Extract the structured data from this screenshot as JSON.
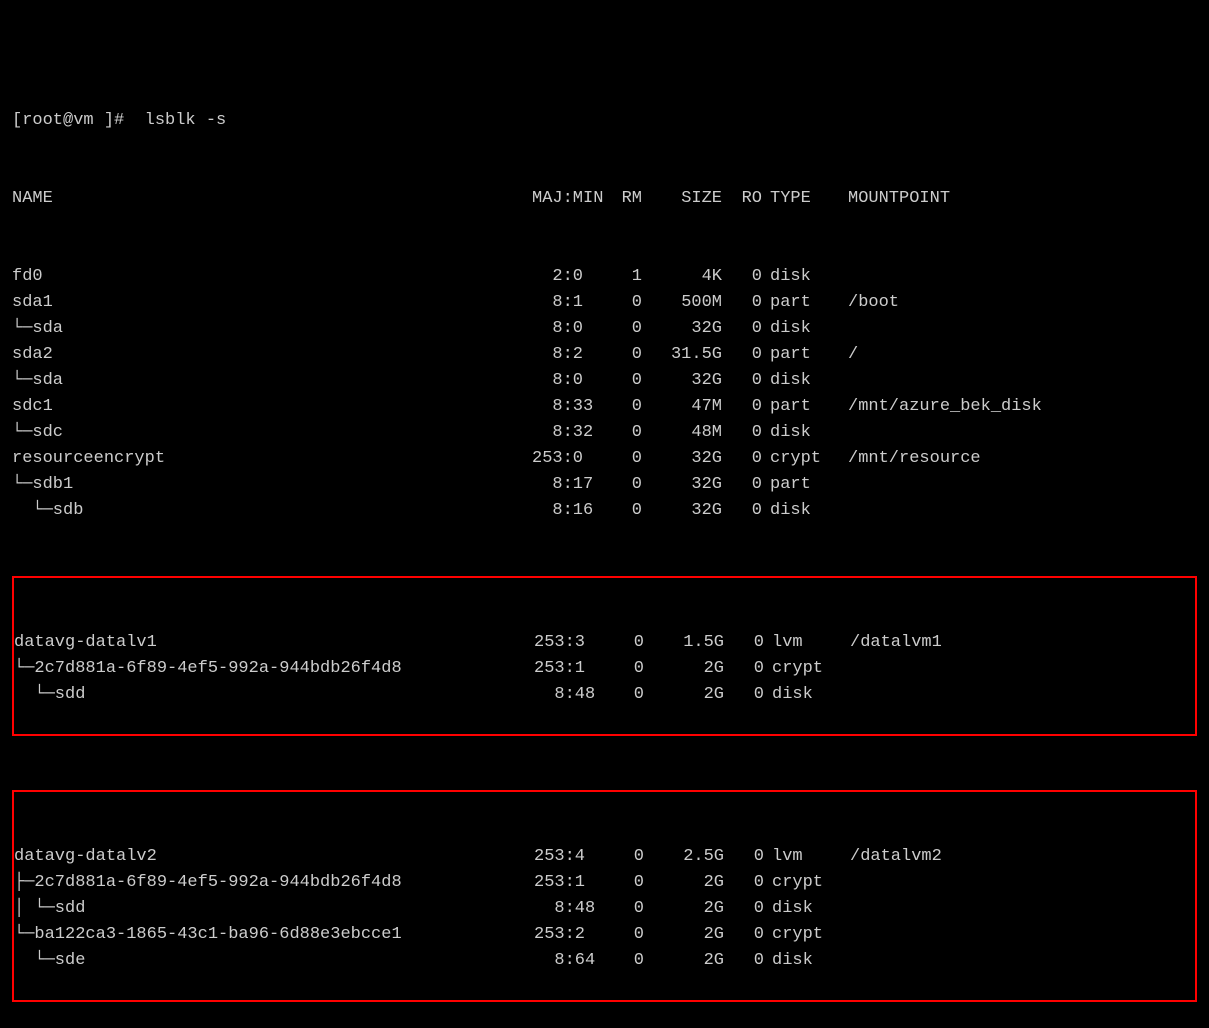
{
  "prompt": "[root@vm ]#  lsblk -s",
  "header": {
    "name": "NAME",
    "majmin": "MAJ:MIN",
    "rm": "RM",
    "size": "SIZE",
    "ro": "RO",
    "type": "TYPE",
    "mount": "MOUNTPOINT"
  },
  "rows": [
    {
      "name": "fd0",
      "maj": "  2:0",
      "rm": "1",
      "size": "4K",
      "ro": "0",
      "type": "disk",
      "mount": ""
    },
    {
      "name": "sda1",
      "maj": "  8:1",
      "rm": "0",
      "size": "500M",
      "ro": "0",
      "type": "part",
      "mount": "/boot"
    },
    {
      "name": "└─sda",
      "maj": "  8:0",
      "rm": "0",
      "size": "32G",
      "ro": "0",
      "type": "disk",
      "mount": ""
    },
    {
      "name": "sda2",
      "maj": "  8:2",
      "rm": "0",
      "size": "31.5G",
      "ro": "0",
      "type": "part",
      "mount": "/"
    },
    {
      "name": "└─sda",
      "maj": "  8:0",
      "rm": "0",
      "size": "32G",
      "ro": "0",
      "type": "disk",
      "mount": ""
    },
    {
      "name": "sdc1",
      "maj": "  8:33",
      "rm": "0",
      "size": "47M",
      "ro": "0",
      "type": "part",
      "mount": "/mnt/azure_bek_disk"
    },
    {
      "name": "└─sdc",
      "maj": "  8:32",
      "rm": "0",
      "size": "48M",
      "ro": "0",
      "type": "disk",
      "mount": ""
    },
    {
      "name": "resourceencrypt",
      "maj": "253:0",
      "rm": "0",
      "size": "32G",
      "ro": "0",
      "type": "crypt",
      "mount": "/mnt/resource"
    },
    {
      "name": "└─sdb1",
      "maj": "  8:17",
      "rm": "0",
      "size": "32G",
      "ro": "0",
      "type": "part",
      "mount": ""
    },
    {
      "name": "  └─sdb",
      "maj": "  8:16",
      "rm": "0",
      "size": "32G",
      "ro": "0",
      "type": "disk",
      "mount": ""
    }
  ],
  "box1": [
    {
      "name": "datavg-datalv1",
      "maj": "253:3",
      "rm": "0",
      "size": "1.5G",
      "ro": "0",
      "type": "lvm",
      "mount": "/datalvm1"
    },
    {
      "name": "└─2c7d881a-6f89-4ef5-992a-944bdb26f4d8",
      "maj": "253:1",
      "rm": "0",
      "size": "2G",
      "ro": "0",
      "type": "crypt",
      "mount": ""
    },
    {
      "name": "  └─sdd",
      "maj": "  8:48",
      "rm": "0",
      "size": "2G",
      "ro": "0",
      "type": "disk",
      "mount": ""
    }
  ],
  "box2": [
    {
      "name": "datavg-datalv2",
      "maj": "253:4",
      "rm": "0",
      "size": "2.5G",
      "ro": "0",
      "type": "lvm",
      "mount": "/datalvm2"
    },
    {
      "name": "├─2c7d881a-6f89-4ef5-992a-944bdb26f4d8",
      "maj": "253:1",
      "rm": "0",
      "size": "2G",
      "ro": "0",
      "type": "crypt",
      "mount": ""
    },
    {
      "name": "│ └─sdd",
      "maj": "  8:48",
      "rm": "0",
      "size": "2G",
      "ro": "0",
      "type": "disk",
      "mount": ""
    },
    {
      "name": "└─ba122ca3-1865-43c1-ba96-6d88e3ebcce1",
      "maj": "253:2",
      "rm": "0",
      "size": "2G",
      "ro": "0",
      "type": "crypt",
      "mount": ""
    },
    {
      "name": "  └─sde",
      "maj": "  8:64",
      "rm": "0",
      "size": "2G",
      "ro": "0",
      "type": "disk",
      "mount": ""
    }
  ]
}
